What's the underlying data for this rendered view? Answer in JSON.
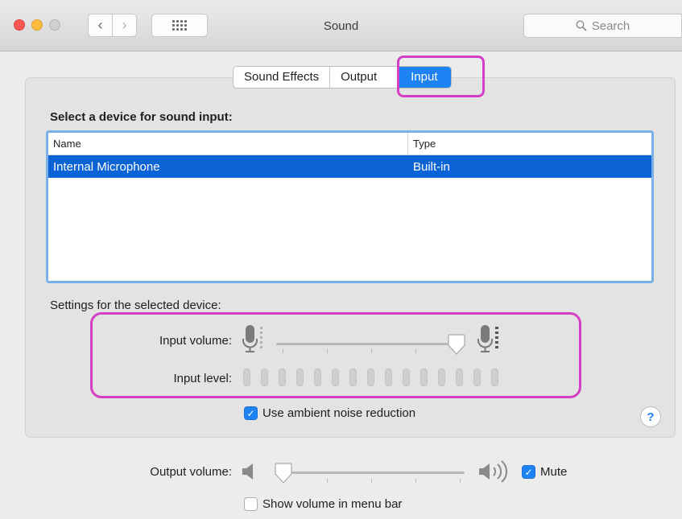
{
  "window": {
    "title": "Sound",
    "search_placeholder": "Search"
  },
  "tabs": [
    {
      "label": "Sound Effects"
    },
    {
      "label": "Output"
    },
    {
      "label": "Input",
      "selected": true
    }
  ],
  "input": {
    "heading": "Select a device for sound input:",
    "columns": {
      "name": "Name",
      "type": "Type"
    },
    "devices": [
      {
        "name": "Internal Microphone",
        "type": "Built-in",
        "selected": true
      }
    ],
    "settings_label": "Settings for the selected device:",
    "input_volume_label": "Input volume:",
    "input_volume_value": 0.95,
    "input_level_label": "Input level:",
    "input_level_segments": 15,
    "ambient_noise_label": "Use ambient noise reduction",
    "ambient_noise_checked": true
  },
  "output": {
    "volume_label": "Output volume:",
    "volume_value": 0.0,
    "mute_label": "Mute",
    "mute_checked": true,
    "show_in_menubar_label": "Show volume in menu bar",
    "show_in_menubar_checked": false
  },
  "help_label": "?",
  "colors": {
    "accent": "#1d82f2",
    "selection": "#0b63d6",
    "highlight": "#d53fc6"
  }
}
